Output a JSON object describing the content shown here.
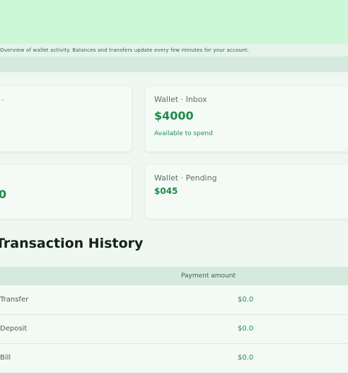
{
  "banner": {
    "note": "Overview of wallet activity. Balances and transfers update every few minutes for your account."
  },
  "cards": {
    "top_left": {
      "edge_text": "-"
    },
    "top_right": {
      "label": "Wallet · Inbox",
      "value": "$4000",
      "sub": "Available to spend"
    },
    "bottom_left": {
      "edge_value": "0"
    },
    "bottom_right": {
      "label": "Wallet · Pending",
      "value": "$045"
    }
  },
  "history": {
    "title": "Transaction History",
    "columns": {
      "amount": "Payment amount"
    },
    "rows": [
      {
        "desc": "Transfer",
        "amount": "$0.0"
      },
      {
        "desc": "Deposit",
        "amount": "$0.0"
      },
      {
        "desc": "Bill",
        "amount": "$0.0"
      }
    ]
  },
  "colors": {
    "accent_green": "#1f8a4c",
    "banner": "#cdf7d9",
    "background": "#eef7f1"
  }
}
